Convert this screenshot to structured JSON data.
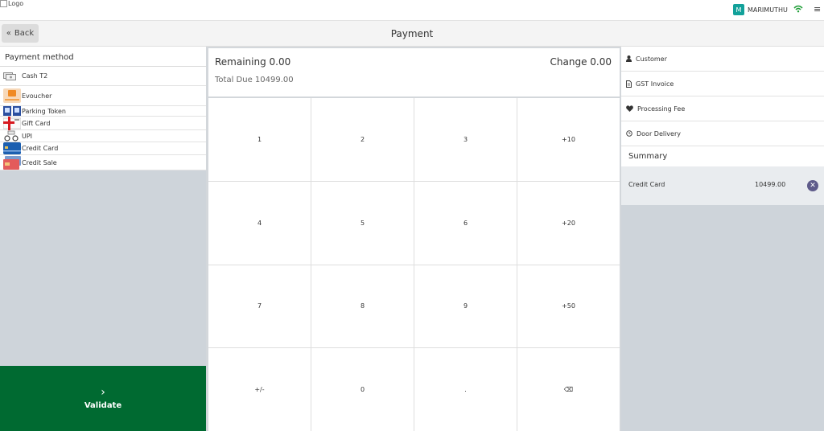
{
  "topbar": {
    "logo_alt": "Logo",
    "user_initial": "M",
    "user_name": "MARIMUTHU",
    "menu_icon": "≡"
  },
  "header": {
    "back_label": "Back",
    "back_icon": "«",
    "title": "Payment"
  },
  "payment_methods": {
    "title": "Payment method",
    "items": [
      {
        "label": "Cash T2"
      },
      {
        "label": "Evoucher"
      },
      {
        "label": "Parking Token"
      },
      {
        "label": "Gift Card"
      },
      {
        "label": "UPI"
      },
      {
        "label": "Credit Card"
      },
      {
        "label": "Credit Sale"
      }
    ],
    "validate_icon": "›",
    "validate_label": "Validate"
  },
  "due": {
    "remaining": "Remaining  0.00",
    "change": "Change  0.00",
    "total_due": "Total Due  10499.00"
  },
  "numpad": [
    "1",
    "2",
    "3",
    "+10",
    "4",
    "5",
    "6",
    "+20",
    "7",
    "8",
    "9",
    "+50",
    "+/-",
    "0",
    ".",
    "⌫"
  ],
  "options": {
    "customer": "Customer",
    "gst_invoice": "GST Invoice",
    "processing_fee": "Processing Fee",
    "door_delivery": "Door Delivery"
  },
  "summary": {
    "title": "Summary",
    "lines": [
      {
        "name": "Credit Card",
        "amount": "10499.00"
      }
    ],
    "remove_icon": "✕"
  },
  "colors": {
    "validate_bg": "#006a31",
    "avatar_bg": "#12a19a",
    "wifi": "#1f9e37",
    "remove_btn": "#5e5b8a"
  }
}
